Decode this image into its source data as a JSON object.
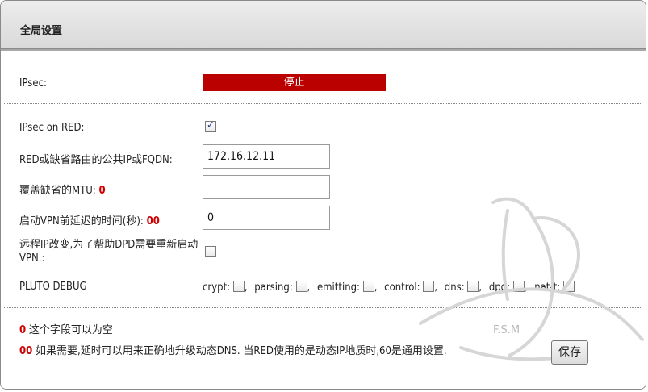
{
  "header": {
    "title": "全局设置"
  },
  "ipsec": {
    "label": "IPsec:",
    "status": "停止",
    "status_color": "#bb0000"
  },
  "form": {
    "ipsec_on_red_label": "IPsec on RED:",
    "public_ip_label": "RED或缺省路由的公共IP或FQDN:",
    "public_ip_value": "172.16.12.11",
    "mtu_label": "覆盖缺省的MTU:",
    "mtu_mark": "0",
    "mtu_value": "",
    "delay_label": "启动VPN前延迟的时间(秒):",
    "delay_mark": "00",
    "delay_value": "0",
    "dpd_restart_label_line1": "远程IP改变,为了帮助DPD需要重新启动",
    "dpd_restart_label_line2": "VPN.:",
    "pluto_debug_label": "PLUTO DEBUG",
    "debug_options": [
      {
        "label": "crypt:",
        "sep": ","
      },
      {
        "label": "parsing:",
        "sep": ","
      },
      {
        "label": "emitting:",
        "sep": ","
      },
      {
        "label": "control:",
        "sep": ","
      },
      {
        "label": "dns:",
        "sep": ","
      },
      {
        "label": "dpd:",
        "sep": ","
      },
      {
        "label": "nat-t:",
        "sep": ""
      }
    ]
  },
  "notes": {
    "note1_mark": "0",
    "note1_text": "这个字段可以为空",
    "note2_mark": "00",
    "note2_text": "如果需要,延时可以用来正确地升级动态DNS. 当RED使用的是动态IP地质时,60是通用设置."
  },
  "actions": {
    "save_label": "保存"
  },
  "watermark": {
    "text": "F.S.M"
  }
}
